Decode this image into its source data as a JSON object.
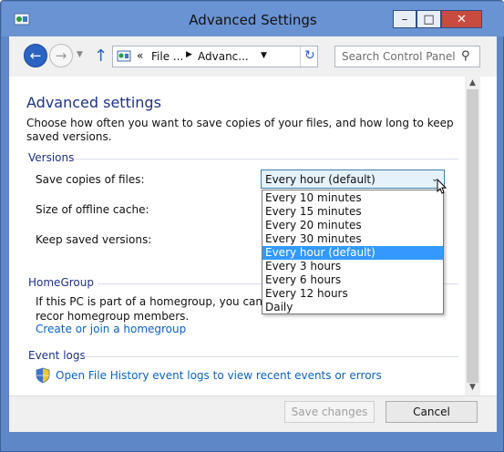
{
  "window": {
    "title": "Advanced Settings",
    "minimize_glyph": "–",
    "maximize_glyph": "□",
    "close_glyph": "✕"
  },
  "nav": {
    "back_glyph": "←",
    "forward_glyph": "→",
    "recent_glyph": "▼",
    "up_glyph": "↑",
    "address": {
      "overflow": "«",
      "crumbs": [
        "File ...",
        "Advanc..."
      ],
      "separator": "▶"
    },
    "refresh_glyph": "↻",
    "search_placeholder": "Search Control Panel",
    "search_glyph": "⚲"
  },
  "page": {
    "title": "Advanced settings",
    "description": "Choose how often you want to save copies of your files, and how long to keep saved versions."
  },
  "versions": {
    "group_label": "Versions",
    "save_copies_label": "Save copies of files:",
    "cache_label": "Size of offline cache:",
    "keep_label": "Keep saved versions:",
    "selected_value": "Every hour (default)",
    "chevron": "⌄",
    "options": [
      "Every 10 minutes",
      "Every 15 minutes",
      "Every 20 minutes",
      "Every 30 minutes",
      "Every hour (default)",
      "Every 3 hours",
      "Every 6 hours",
      "Every 12 hours",
      "Daily"
    ],
    "selected_index": 4
  },
  "homegroup": {
    "group_label": "HomeGroup",
    "text": "If this PC is part of a homegroup, you can recor homegroup members.",
    "link": "Create or join a homegroup"
  },
  "eventlogs": {
    "group_label": "Event logs",
    "link": "Open File History event logs to view recent events or errors"
  },
  "footer": {
    "save_label": "Save changes",
    "cancel_label": "Cancel"
  },
  "scrollbar": {
    "up_glyph": "▲",
    "down_glyph": "▼"
  },
  "colors": {
    "title_bar": "#6a93d3",
    "heading": "#1e3287",
    "link": "#0b63c4",
    "selection": "#3399ff"
  }
}
